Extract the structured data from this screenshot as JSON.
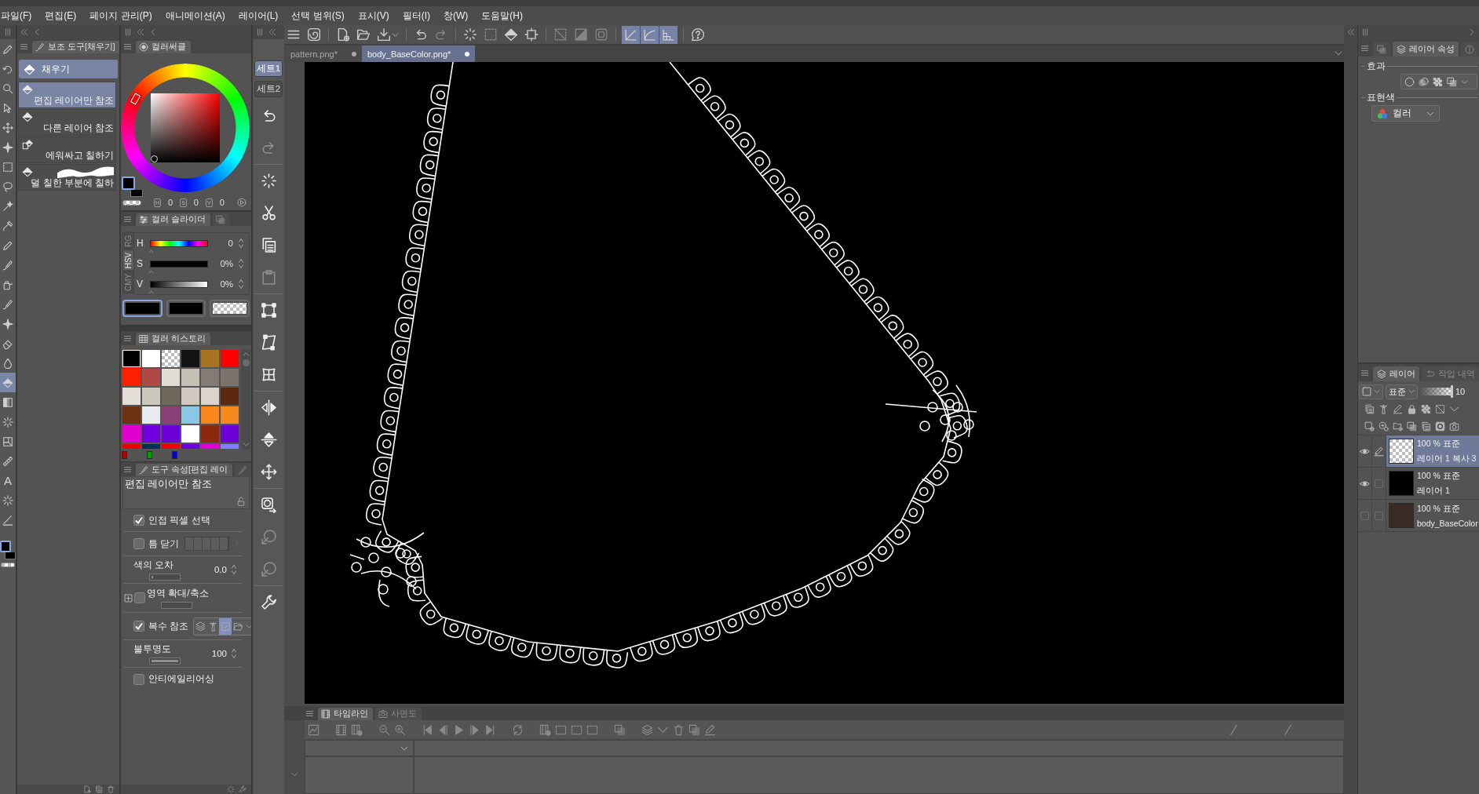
{
  "menu": [
    "파일(F)",
    "편집(E)",
    "페이지 관리(P)",
    "애니메이션(A)",
    "레이어(L)",
    "선택 범위(S)",
    "표시(V)",
    "필터(I)",
    "창(W)",
    "도움말(H)"
  ],
  "tools": [
    {
      "kind": "pen",
      "selected": false
    },
    {
      "kind": "rotate",
      "selected": false
    },
    {
      "kind": "magnifier",
      "selected": false
    },
    {
      "kind": "cursor",
      "selected": false
    },
    {
      "kind": "move",
      "selected": false
    },
    {
      "kind": "sparkle",
      "selected": false
    },
    {
      "kind": "marquee",
      "selected": false
    },
    {
      "kind": "lasso",
      "selected": false
    },
    {
      "kind": "wand",
      "selected": false
    },
    {
      "kind": "eyedropper",
      "selected": false
    },
    {
      "kind": "pen",
      "selected": false
    },
    {
      "kind": "brush",
      "selected": false
    },
    {
      "kind": "airbrush",
      "selected": false
    },
    {
      "kind": "brush",
      "selected": false
    },
    {
      "kind": "sparkle",
      "selected": false
    },
    {
      "kind": "eraser",
      "selected": false
    },
    {
      "kind": "drop",
      "selected": false
    },
    {
      "kind": "bucket",
      "selected": true
    },
    {
      "kind": "gradient",
      "selected": false
    },
    {
      "kind": "burst",
      "selected": false
    },
    {
      "kind": "frame",
      "selected": false
    },
    {
      "kind": "ruler",
      "selected": false
    },
    {
      "kind": "text",
      "glyph": "A",
      "selected": false
    },
    {
      "kind": "burst",
      "selected": false
    },
    {
      "kind": "line",
      "selected": false
    }
  ],
  "sub_tool": {
    "tab": "보조 도구[채우기]",
    "group": "채우기",
    "items": [
      {
        "kind": "refer",
        "label": "편집 레이어만 참조",
        "selected": true
      },
      {
        "kind": "refer",
        "label": "다른 레이어 참조",
        "selected": false
      },
      {
        "kind": "enclose",
        "label": "에워싸고 칠하기",
        "selected": false
      },
      {
        "kind": "unpainted",
        "label": "덜 칠한 부분에 칠하",
        "selected": false
      }
    ]
  },
  "color_circle": {
    "tab": "컬러써클",
    "readouts": [
      {
        "label": "H",
        "value": "0"
      },
      {
        "label": "S",
        "value": "0"
      },
      {
        "label": "V",
        "value": "0"
      }
    ]
  },
  "color_slider": {
    "tabs": [
      {
        "kind": "sliders",
        "label": "컬러 슬라이더",
        "selected": true
      },
      {
        "kind": "squares",
        "selected": false
      }
    ],
    "modes": [
      {
        "label": "RG",
        "selected": false
      },
      {
        "label": "HSV",
        "selected": true
      },
      {
        "label": "CMY",
        "selected": false
      }
    ],
    "sliders": [
      {
        "kind": "hue",
        "label": "H",
        "reading": "0",
        "level": 0
      },
      {
        "kind": "saturation",
        "label": "S",
        "reading": "0%",
        "level": 0
      },
      {
        "kind": "value",
        "label": "V",
        "reading": "0%",
        "level": 0
      }
    ],
    "swatches": [
      {
        "kind": "main",
        "color": "#000000",
        "selected": true
      },
      {
        "kind": "sub",
        "color": "#000000",
        "selected": false
      },
      {
        "kind": "transparent",
        "selected": false
      }
    ]
  },
  "color_history": {
    "tab": "컬러 히스토리",
    "colors": [
      {
        "kind": "color",
        "color": "#000000",
        "selected": true
      },
      {
        "kind": "color",
        "color": "#ffffff",
        "selected": false
      },
      {
        "kind": "transparent",
        "selected": false
      },
      {
        "kind": "color",
        "color": "#141414",
        "selected": false
      },
      {
        "kind": "color",
        "color": "#a87420",
        "selected": false
      },
      {
        "kind": "color",
        "color": "#ff0000",
        "selected": false
      },
      {
        "kind": "color",
        "color": "#ff2000",
        "selected": false
      },
      {
        "kind": "color",
        "color": "#b04848",
        "selected": false
      },
      {
        "kind": "color",
        "color": "#e2dcd4",
        "selected": false
      },
      {
        "kind": "color",
        "color": "#c6c0b4",
        "selected": false
      },
      {
        "kind": "color",
        "color": "#847c74",
        "selected": false
      },
      {
        "kind": "color",
        "color": "#7c746c",
        "selected": false
      },
      {
        "kind": "color",
        "color": "#e4ded6",
        "selected": false
      },
      {
        "kind": "color",
        "color": "#ccc8bc",
        "selected": false
      },
      {
        "kind": "color",
        "color": "#706858",
        "selected": false
      },
      {
        "kind": "color",
        "color": "#d0c8be",
        "selected": false
      },
      {
        "kind": "color",
        "color": "#dcd4ca",
        "selected": false
      },
      {
        "kind": "color",
        "color": "#5c2810",
        "selected": false
      },
      {
        "kind": "color",
        "color": "#6a3414",
        "selected": false
      },
      {
        "kind": "color",
        "color": "#e8ecee",
        "selected": false
      },
      {
        "kind": "color",
        "color": "#884078",
        "selected": false
      },
      {
        "kind": "color",
        "color": "#88c8e4",
        "selected": false
      },
      {
        "kind": "color",
        "color": "#f8881c",
        "selected": false
      },
      {
        "kind": "color",
        "color": "#f8881c",
        "selected": false
      },
      {
        "kind": "color",
        "color": "#e000d0",
        "selected": false
      },
      {
        "kind": "color",
        "color": "#7000e0",
        "selected": false
      },
      {
        "kind": "color",
        "color": "#6c00d8",
        "selected": false
      },
      {
        "kind": "color",
        "color": "#ffffff",
        "selected": false
      },
      {
        "kind": "color",
        "color": "#8c2810",
        "selected": false
      },
      {
        "kind": "color",
        "color": "#7000d8",
        "selected": false
      },
      {
        "kind": "color",
        "color": "#e80000",
        "selected": false
      },
      {
        "kind": "color",
        "color": "#003058",
        "selected": false
      },
      {
        "kind": "color",
        "color": "#ee0000",
        "selected": false
      },
      {
        "kind": "color",
        "color": "#7000e0",
        "selected": false
      },
      {
        "kind": "color",
        "color": "#e000d0",
        "selected": false
      },
      {
        "kind": "color",
        "color": "#8080ff",
        "selected": false
      }
    ],
    "channels": [
      {
        "color": "#b00000"
      },
      {
        "color": "#00a000"
      },
      {
        "color": "#0000d0"
      }
    ]
  },
  "tool_property": {
    "tabs": [
      {
        "kind": "brush",
        "label": "도구 속성[편집 레이",
        "selected": true
      },
      {
        "kind": "brush",
        "selected": false
      }
    ],
    "title": "편집 레이어만 참조",
    "rows": [
      {
        "kind": "checkbox",
        "label": "인접 픽셀 선택",
        "checked": true
      },
      {
        "kind": "gap",
        "label": "틈 닫기",
        "checked": false
      },
      {
        "kind": "number",
        "label": "색의 오차",
        "value": "0.0",
        "level": 0
      },
      {
        "kind": "expand",
        "label": "영역 확대/축소",
        "checked": false
      },
      {
        "kind": "multi",
        "label": "복수 참조",
        "checked": true,
        "options": [
          {
            "kind": "layers",
            "selected": false
          },
          {
            "kind": "tower",
            "selected": false
          },
          {
            "kind": "paper",
            "selected": true
          },
          {
            "kind": "folder",
            "selected": false
          }
        ]
      },
      {
        "kind": "number",
        "label": "불투명도",
        "value": "100",
        "level": 1
      },
      {
        "kind": "checkbox",
        "label": "안티에일리어싱",
        "checked": false
      }
    ]
  },
  "command_sets": [
    {
      "label": "세트1",
      "selected": true
    },
    {
      "label": "세트2",
      "selected": false
    }
  ],
  "commands": [
    {
      "kind": "undo",
      "disabled": false
    },
    {
      "kind": "redo",
      "disabled": true
    },
    {
      "kind": "ring",
      "disabled": false
    },
    {
      "kind": "cut",
      "disabled": false
    },
    {
      "kind": "copy",
      "disabled": false
    },
    {
      "kind": "paste",
      "disabled": true
    },
    {
      "kind": "transform",
      "disabled": false
    },
    {
      "kind": "skew",
      "disabled": false
    },
    {
      "kind": "mesh",
      "disabled": false
    },
    {
      "kind": "fliph",
      "disabled": false
    },
    {
      "kind": "flipv",
      "disabled": false
    },
    {
      "kind": "move",
      "disabled": false
    },
    {
      "kind": "swap",
      "disabled": false
    },
    {
      "kind": "rotate",
      "disabled": true
    },
    {
      "kind": "rotate",
      "disabled": true
    },
    {
      "kind": "settings",
      "disabled": false
    }
  ],
  "toolbar": [
    {
      "kind": "menu",
      "disabled": false
    },
    {
      "kind": "logo",
      "disabled": false
    },
    {
      "kind": "new",
      "disabled": false
    },
    {
      "kind": "open",
      "disabled": false
    },
    {
      "kind": "save",
      "disabled": false
    },
    {
      "kind": "undo",
      "disabled": false
    },
    {
      "kind": "redo",
      "disabled": true
    },
    {
      "kind": "ring",
      "disabled": false
    },
    {
      "kind": "marquee",
      "disabled": true
    },
    {
      "kind": "bucket",
      "disabled": false
    },
    {
      "kind": "crop",
      "disabled": false
    },
    {
      "kind": "hide",
      "disabled": true
    },
    {
      "kind": "invert",
      "disabled": true
    },
    {
      "kind": "border",
      "disabled": true
    }
  ],
  "snap_buttons": [
    {
      "kind": "ruler",
      "on": true
    },
    {
      "kind": "curve",
      "on": true
    },
    {
      "kind": "grid",
      "on": true
    }
  ],
  "document_tabs": [
    {
      "label": "pattern.png*",
      "selected": false
    },
    {
      "label": "body_BaseColor.png*",
      "selected": true
    }
  ],
  "timeline": {
    "tabs": [
      {
        "kind": "film",
        "label": "타임라인",
        "selected": true
      },
      {
        "kind": "camera",
        "label": "사면도",
        "selected": false
      }
    ]
  },
  "layer_property": {
    "tabs": [
      {
        "kind": "squares",
        "selected": false
      },
      {
        "kind": "layers",
        "label": "레이어 속성",
        "selected": true
      },
      {
        "kind": "info",
        "selected": false
      }
    ],
    "effect_label": "효과",
    "color_label": "표현색",
    "color_mode": "컬러"
  },
  "layers_panel": {
    "tabs": [
      {
        "kind": "layers",
        "label": "레이어",
        "selected": true
      },
      {
        "kind": "history",
        "label": "작업 내역",
        "selected": false
      }
    ],
    "blend_mode": "표준",
    "opacity": {
      "value": "10",
      "level": 1
    },
    "layers": [
      {
        "kind": "transparent",
        "label": "100 % 표준",
        "name": "레이어 1 복사 3",
        "visible": true,
        "editing": true,
        "selected": true
      },
      {
        "kind": "black",
        "label": "100 % 표준",
        "name": "레이어 1",
        "visible": true,
        "editing": false,
        "selected": false
      },
      {
        "kind": "photo",
        "label": "100 % 표준",
        "name": "body_BaseColor",
        "visible": false,
        "editing": false,
        "selected": false
      }
    ]
  }
}
